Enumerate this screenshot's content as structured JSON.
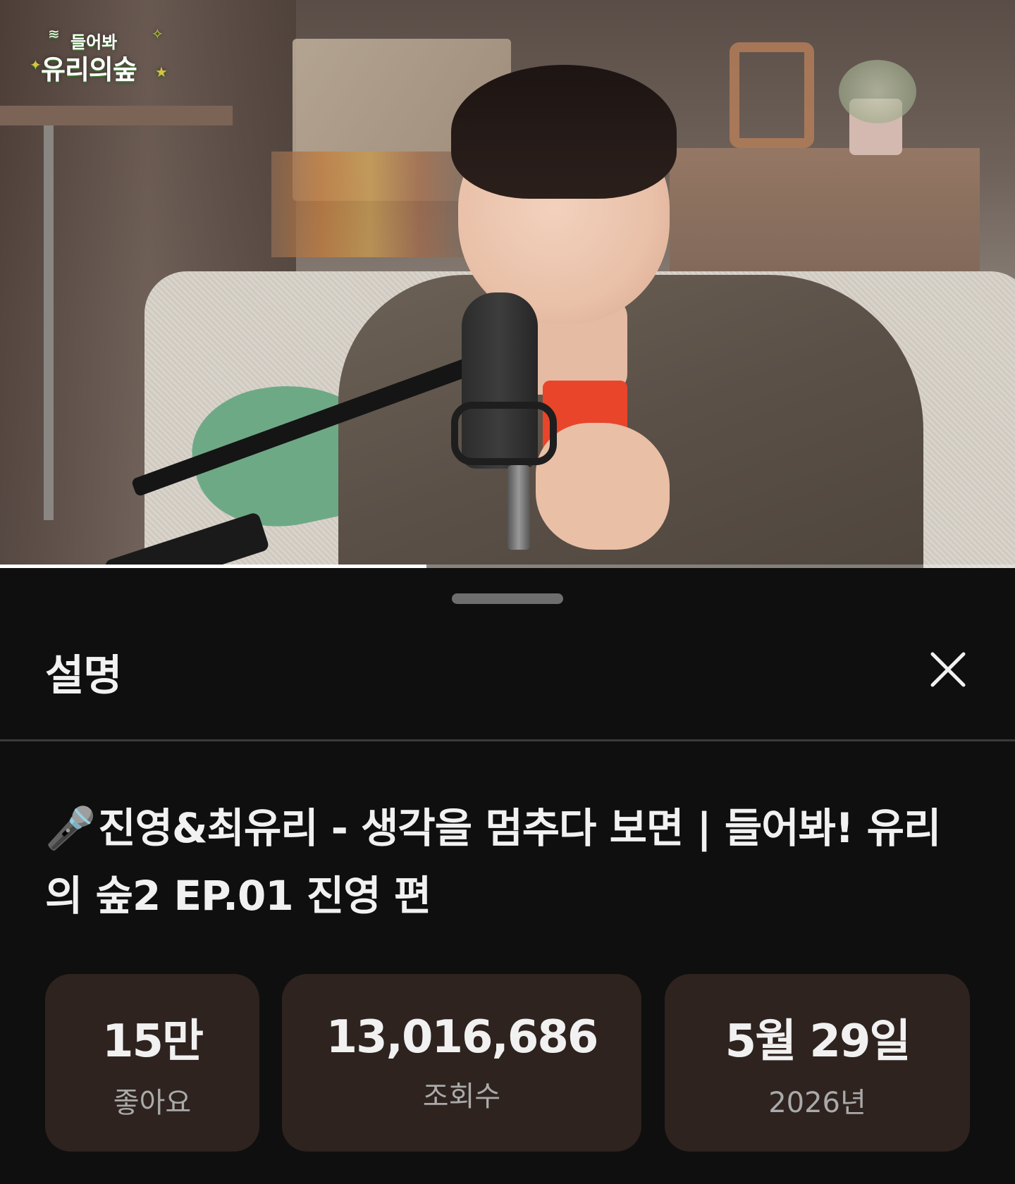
{
  "video": {
    "channel_logo": {
      "line1": "들어봐",
      "line2": "유리의숲"
    },
    "playback_progress": 0.42
  },
  "sheet": {
    "title": "설명",
    "close_label": "close",
    "video_title_emoji": "🎤",
    "video_title": "진영&최유리 - 생각을 멈추다 보면 | 들어봐! 유리의 숲2 EP.01 진영 편",
    "stats": [
      {
        "value": "15만",
        "label": "좋아요"
      },
      {
        "value": "13,016,686",
        "label": "조회수"
      },
      {
        "value": "5월 29일",
        "label": "2026년"
      }
    ]
  },
  "colors": {
    "background": "#0f0f0f",
    "stat_card": "#2e231f",
    "text_primary": "#f1f1f1",
    "text_secondary": "#aaaaaa"
  },
  "icons": {
    "close": "close-icon",
    "title_prefix": "microphone-icon"
  }
}
